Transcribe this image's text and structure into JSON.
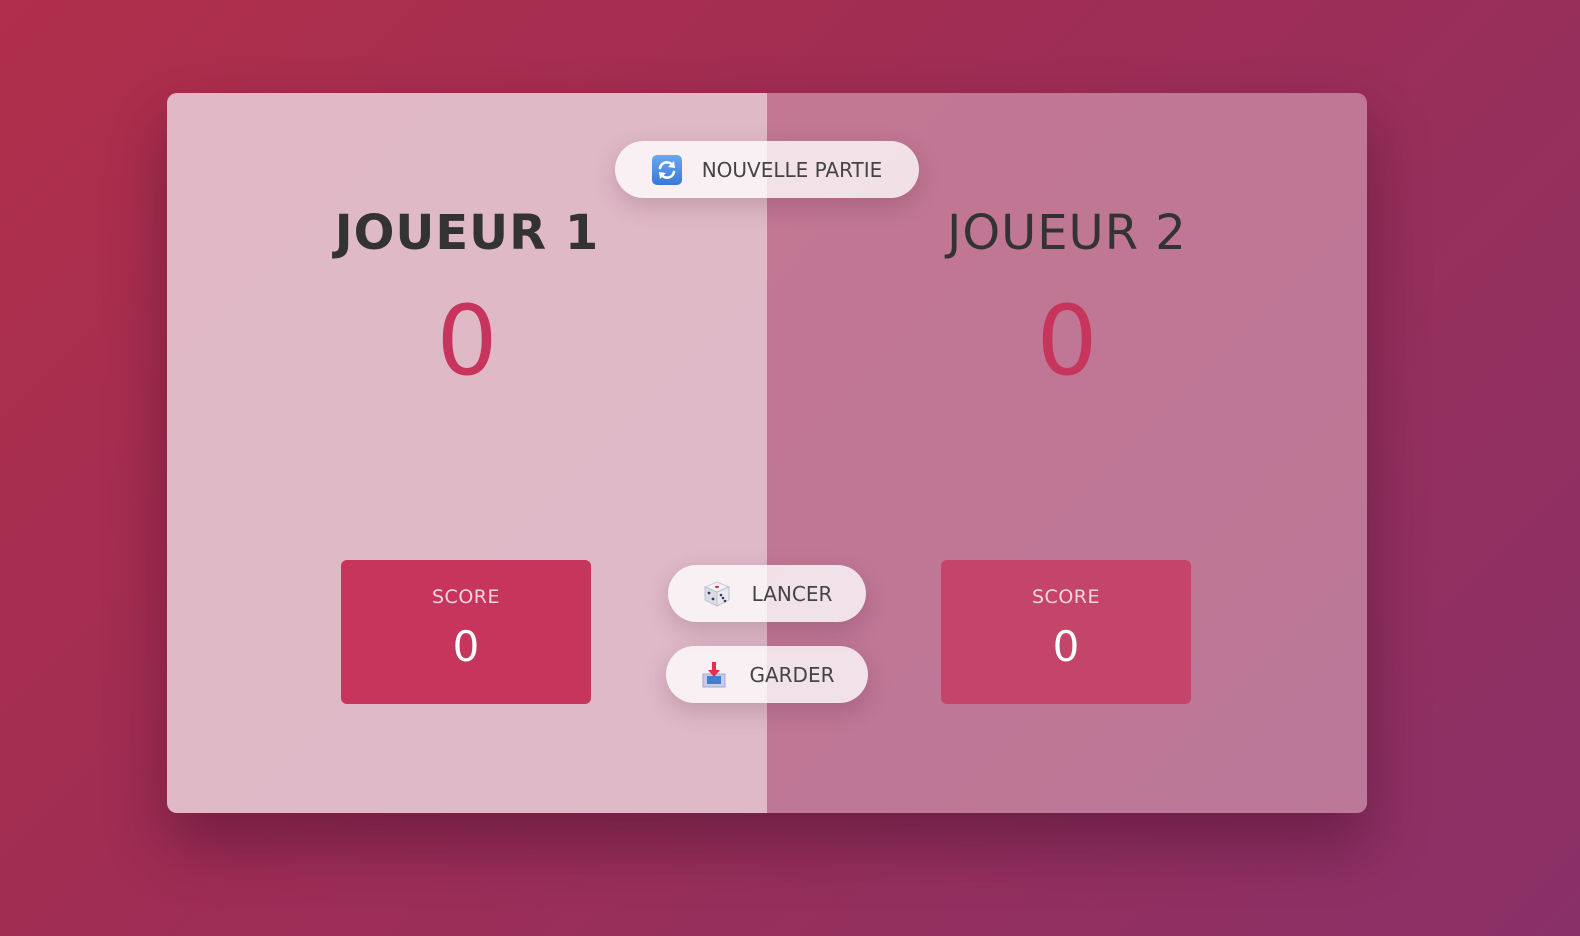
{
  "players": [
    {
      "name": "JOUEUR 1",
      "total_score": "0",
      "current_label": "SCORE",
      "current_score": "0"
    },
    {
      "name": "JOUEUR 2",
      "total_score": "0",
      "current_label": "SCORE",
      "current_score": "0"
    }
  ],
  "controls": {
    "new_game": {
      "label": "NOUVELLE PARTIE",
      "icon": "refresh-icon"
    },
    "roll": {
      "label": "LANCER",
      "icon": "dice-icon"
    },
    "hold": {
      "label": "GARDER",
      "icon": "inbox-tray-icon"
    }
  },
  "colors": {
    "accent": "#c7345c",
    "player_1_panel": "#e8cdd7",
    "player_2_panel": "#d7a5b9",
    "background_start": "#b02f4a",
    "background_end": "#8a3068"
  }
}
